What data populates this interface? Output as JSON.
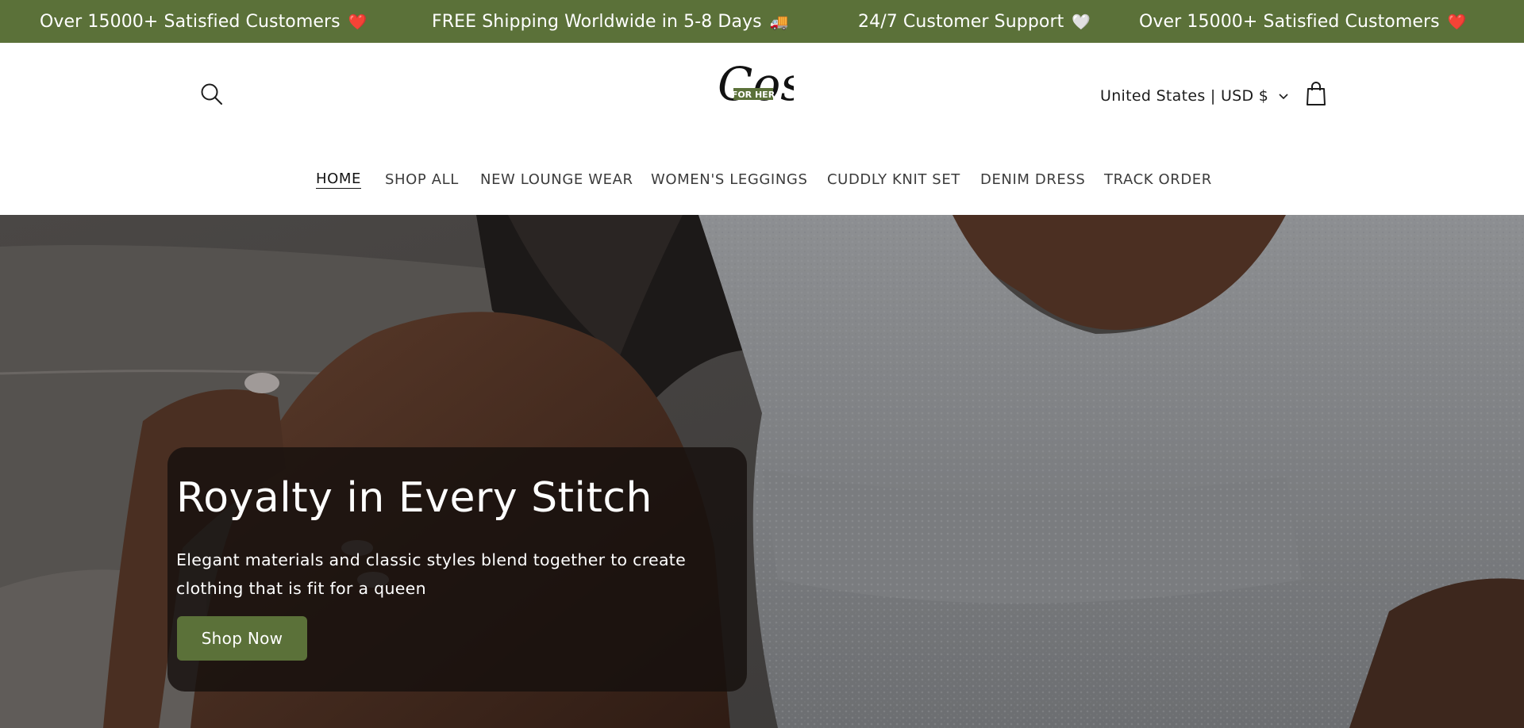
{
  "announcement": {
    "items": [
      {
        "text": "Over 15000+ Satisfied Customers",
        "emoji": "❤️"
      },
      {
        "text": "FREE Shipping Worldwide in 5-8 Days",
        "emoji": "🚚"
      },
      {
        "text": "24/7 Customer Support",
        "emoji": "🤍"
      },
      {
        "text": "Over 15000+ Satisfied Customers",
        "emoji": "❤️"
      }
    ],
    "background": "#5b7139"
  },
  "header": {
    "logo": {
      "main": "Cosy",
      "tag": "FOR HER"
    },
    "localization": "United States | USD $",
    "icons": {
      "search": "search-icon",
      "cart": "cart-icon",
      "chevron": "chevron-down-icon"
    }
  },
  "nav": {
    "items": [
      {
        "label": "HOME",
        "active": true
      },
      {
        "label": "SHOP ALL"
      },
      {
        "label": "NEW LOUNGE WEAR"
      },
      {
        "label": "WOMEN'S LEGGINGS"
      },
      {
        "label": "CUDDLY KNIT SET"
      },
      {
        "label": "DENIM DRESS"
      },
      {
        "label": "TRACK ORDER"
      }
    ]
  },
  "hero": {
    "title": "Royalty in Every Stitch",
    "text": "Elegant materials and classic styles blend together to create clothing that is fit for a queen",
    "button": "Shop Now",
    "accent": "#5b7139"
  }
}
